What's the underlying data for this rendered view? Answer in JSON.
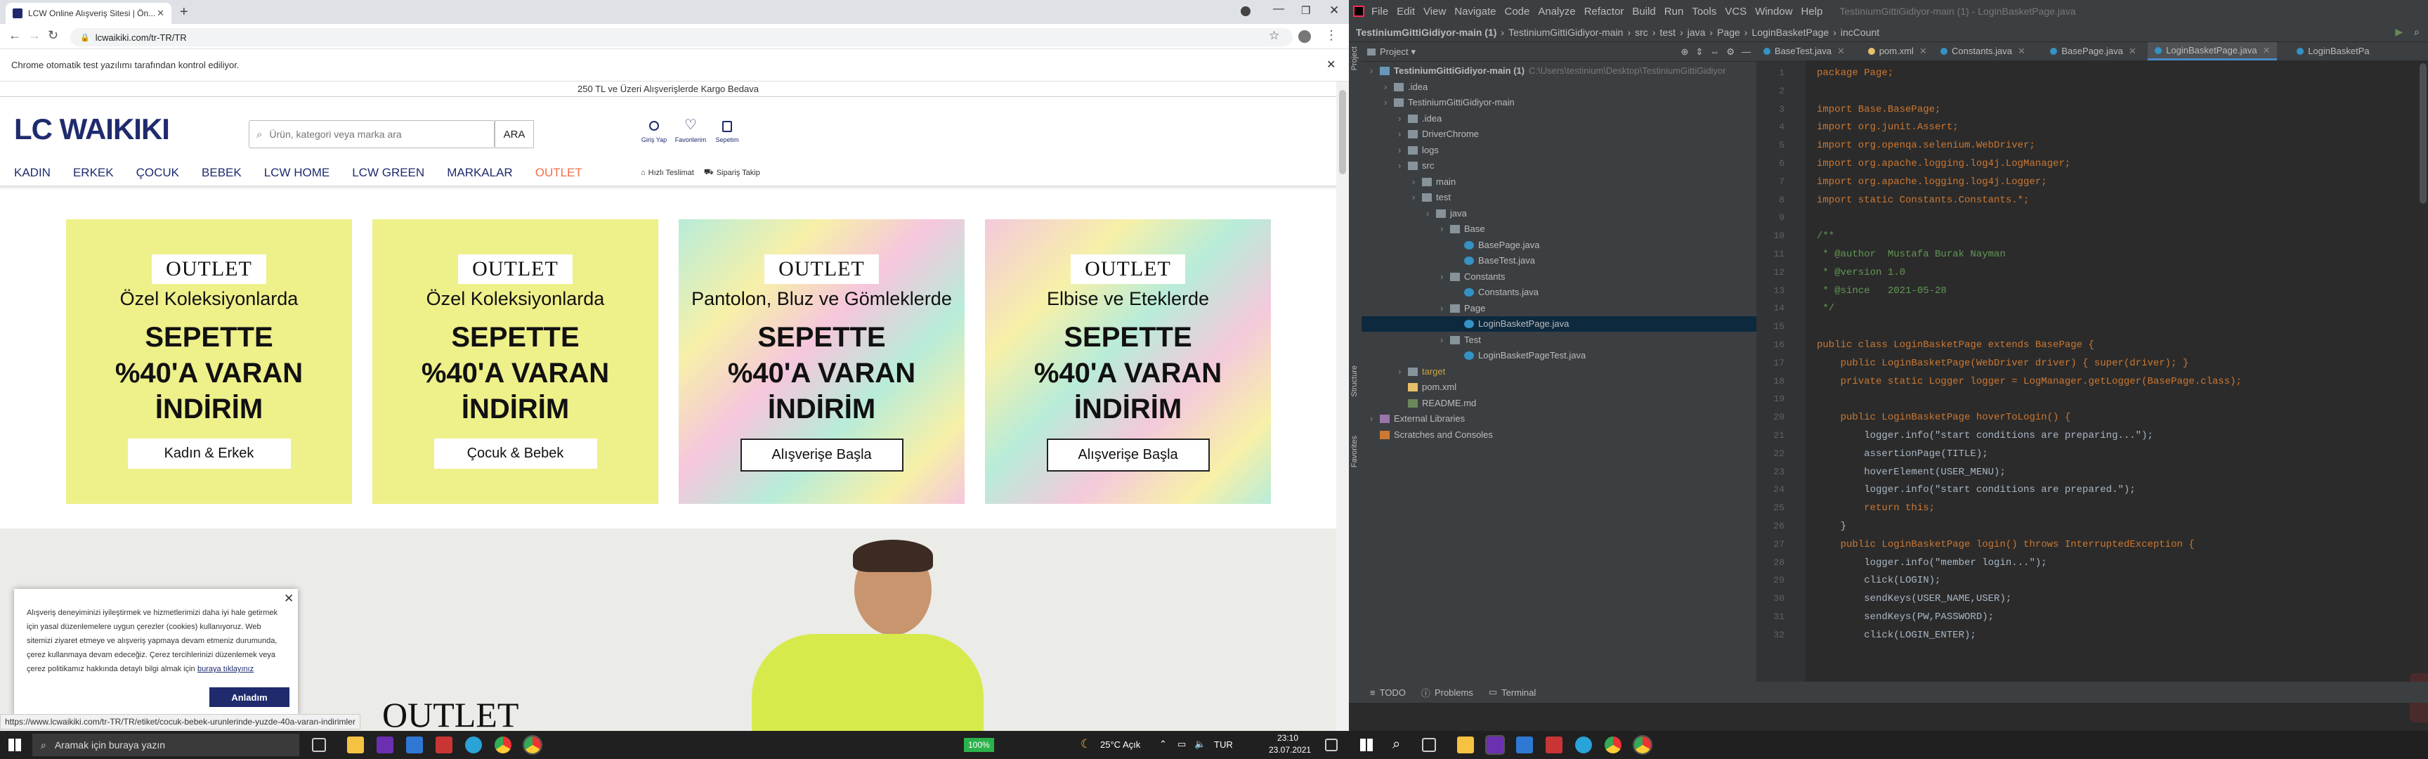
{
  "chrome": {
    "tab_title": "LCW Online Alışveriş Sitesi | Ön...",
    "url": "lcwaikiki.com/tr-TR/TR",
    "infobar_text": "Chrome otomatik test yazılımı tarafından kontrol ediliyor.",
    "status_url": "https://www.lcwaikiki.com/tr-TR/TR/etiket/cocuk-bebek-urunlerinde-yuzde-40a-varan-indirimler"
  },
  "site": {
    "shipping_banner": "250 TL ve Üzeri Alışverişlerde Kargo Bedava",
    "logo": "LC WAIKIKI",
    "search_placeholder": "Ürün, kategori veya marka ara",
    "search_button": "ARA",
    "header_icons": [
      {
        "label": "Giriş Yap",
        "icon": "user-icon"
      },
      {
        "label": "Favorilerim",
        "icon": "heart-icon"
      },
      {
        "label": "Sepetim",
        "icon": "bag-icon"
      }
    ],
    "nav": [
      "KADIN",
      "ERKEK",
      "ÇOCUK",
      "BEBEK",
      "LCW HOME",
      "LCW GREEN",
      "MARKALAR",
      "OUTLET"
    ],
    "nav_accent": "#f26f4a",
    "quick_links": [
      "Hızlı Teslimat",
      "Sipariş Takip"
    ],
    "cards": [
      {
        "tag": "OUTLET",
        "subtitle": "Özel Koleksiyonlarda",
        "line1": "SEPETTE",
        "line2": "%40'A VARAN",
        "line3": "İNDİRİM",
        "button": "Kadın & Erkek",
        "bg": "#eef08a"
      },
      {
        "tag": "OUTLET",
        "subtitle": "Özel Koleksiyonlarda",
        "line1": "SEPETTE",
        "line2": "%40'A VARAN",
        "line3": "İNDİRİM",
        "button": "Çocuk & Bebek",
        "bg": "#eef08a"
      },
      {
        "tag": "OUTLET",
        "subtitle": "Pantolon, Bluz ve Gömleklerde",
        "line1": "SEPETTE",
        "line2": "%40'A VARAN",
        "line3": "İNDİRİM",
        "button": "Alışverişe Başla",
        "bg": "#b8ecd9"
      },
      {
        "tag": "OUTLET",
        "subtitle": "Elbise ve Eteklerde",
        "line1": "SEPETTE",
        "line2": "%40'A VARAN",
        "line3": "İNDİRİM",
        "button": "Alışverişe Başla",
        "bg": "#f3c9dc"
      }
    ],
    "hero_title": "OUTLET",
    "cookie_text": "Alışveriş deneyiminizi iyileştirmek ve hizmetlerimizi daha iyi hale getirmek için yasal düzenlemelere uygun çerezler (cookies) kullanıyoruz. Web sitemizi ziyaret etmeye ve alışveriş yapmaya devam etmeniz durumunda, çerez kullanmaya devam edeceğiz. Çerez tercihlerinizi düzenlemek veya çerez politikamız hakkında detaylı bilgi almak için",
    "cookie_link": "buraya tıklayınız",
    "cookie_button": "Anladım"
  },
  "taskbar_left": {
    "search_placeholder": "Aramak için buraya yazın",
    "battery": "100%",
    "weather": "25°C Açık",
    "lang": "TUR",
    "time": "23:10",
    "date": "23.07.2021"
  },
  "ide": {
    "menu": [
      "File",
      "Edit",
      "View",
      "Navigate",
      "Code",
      "Analyze",
      "Refactor",
      "Build",
      "Run",
      "Tools",
      "VCS",
      "Window",
      "Help"
    ],
    "window_title": "TestiniumGittiGidiyor-main (1) - LoginBasketPage.java",
    "breadcrumb": [
      "TestiniumGittiGidiyor-main (1)",
      "TestiniumGittiGidiyor-main",
      "src",
      "test",
      "java",
      "Page",
      "LoginBasketPage",
      "incCount"
    ],
    "project_label": "Project",
    "tree": [
      {
        "text": "TestiniumGittiGidiyor-main (1)",
        "extra": "C:\\Users\\testinium\\Desktop\\TestiniumGittiGidiyor",
        "level": 0,
        "type": "module"
      },
      {
        "text": ".idea",
        "level": 1,
        "type": "folder"
      },
      {
        "text": "TestiniumGittiGidiyor-main",
        "level": 1,
        "type": "folder"
      },
      {
        "text": ".idea",
        "level": 2,
        "type": "folder"
      },
      {
        "text": "DriverChrome",
        "level": 2,
        "type": "folder"
      },
      {
        "text": "logs",
        "level": 2,
        "type": "folder"
      },
      {
        "text": "src",
        "level": 2,
        "type": "folder"
      },
      {
        "text": "main",
        "level": 3,
        "type": "folder"
      },
      {
        "text": "test",
        "level": 3,
        "type": "folder"
      },
      {
        "text": "java",
        "level": 4,
        "type": "folder"
      },
      {
        "text": "Base",
        "level": 5,
        "type": "folder"
      },
      {
        "text": "BasePage.java",
        "level": 6,
        "type": "java"
      },
      {
        "text": "BaseTest.java",
        "level": 6,
        "type": "java"
      },
      {
        "text": "Constants",
        "level": 5,
        "type": "folder"
      },
      {
        "text": "Constants.java",
        "level": 6,
        "type": "java"
      },
      {
        "text": "Page",
        "level": 5,
        "type": "folder"
      },
      {
        "text": "LoginBasketPage.java",
        "level": 6,
        "type": "java",
        "selected": true
      },
      {
        "text": "Test",
        "level": 5,
        "type": "folder"
      },
      {
        "text": "LoginBasketPageTest.java",
        "level": 6,
        "type": "java"
      },
      {
        "text": "target",
        "level": 2,
        "type": "folder"
      },
      {
        "text": "pom.xml",
        "level": 2,
        "type": "xml"
      },
      {
        "text": "README.md",
        "level": 2,
        "type": "md"
      },
      {
        "text": "External Libraries",
        "level": 0,
        "type": "lib"
      },
      {
        "text": "Scratches and Consoles",
        "level": 0,
        "type": "scratch"
      }
    ],
    "editor_tabs": [
      "BaseTest.java",
      "pom.xml",
      "Constants.java",
      "BasePage.java",
      "LoginBasketPage.java",
      "LoginBasketPa"
    ],
    "active_tab": 4,
    "code_lines": [
      "package Page;",
      "",
      "import Base.BasePage;",
      "import org.junit.Assert;",
      "import org.openqa.selenium.WebDriver;",
      "import org.apache.logging.log4j.LogManager;",
      "import org.apache.logging.log4j.Logger;",
      "import static Constants.Constants.*;",
      "",
      "/**",
      " * @author  Mustafa Burak Nayman",
      " * @version 1.0",
      " * @since   2021-05-28",
      " */",
      "",
      "public class LoginBasketPage extends BasePage {",
      "    public LoginBasketPage(WebDriver driver) { super(driver); }",
      "    private static Logger logger = LogManager.getLogger(BasePage.class);",
      "",
      "    public LoginBasketPage hoverToLogin() {",
      "        logger.info(\"start conditions are preparing...\");",
      "        assertionPage(TITLE);",
      "        hoverElement(USER_MENU);",
      "        logger.info(\"start conditions are prepared.\");",
      "        return this;",
      "    }",
      "    public LoginBasketPage login() throws InterruptedException {",
      "        logger.info(\"member login...\");",
      "        click(LOGIN);",
      "        sendKeys(USER_NAME,USER);",
      "        sendKeys(PW,PASSWORD);",
      "        click(LOGIN_ENTER);"
    ],
    "bottom_tabs": [
      "TODO",
      "Problems",
      "Terminal"
    ],
    "side_tools": [
      "Structure",
      "Favorites"
    ]
  }
}
